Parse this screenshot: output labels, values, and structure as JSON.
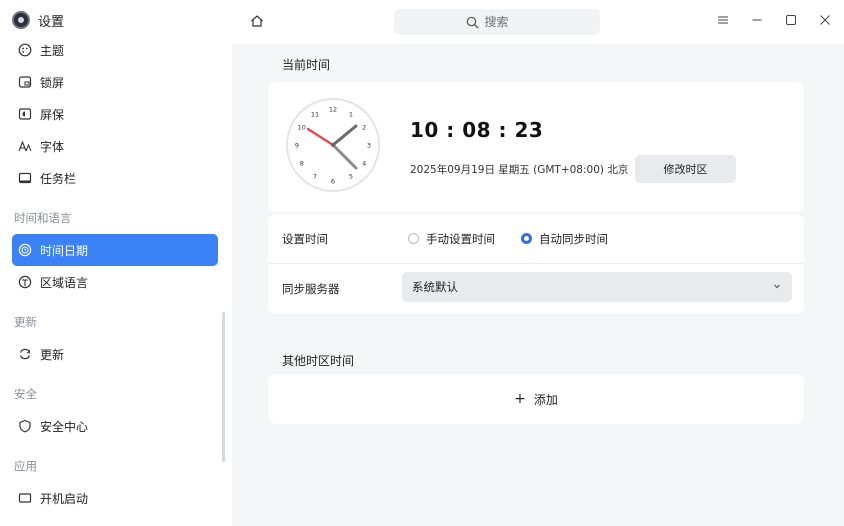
{
  "app": {
    "title": "设置",
    "logo_icon": "settings-app-icon"
  },
  "search": {
    "placeholder": "搜索",
    "icon": "search-icon"
  },
  "window_controls": {
    "menu": "menu-icon",
    "minimize": "minimize-icon",
    "maximize": "maximize-icon",
    "close": "close-icon"
  },
  "sidebar": {
    "items_top": [
      {
        "label": "主题",
        "icon": "theme-icon"
      },
      {
        "label": "锁屏",
        "icon": "lockscreen-icon"
      },
      {
        "label": "屏保",
        "icon": "screensaver-icon"
      },
      {
        "label": "字体",
        "icon": "font-icon"
      },
      {
        "label": "任务栏",
        "icon": "taskbar-icon"
      }
    ],
    "section_time": "时间和语言",
    "items_time": [
      {
        "label": "时间日期",
        "icon": "clock-icon",
        "active": true
      },
      {
        "label": "区域语言",
        "icon": "globe-icon"
      }
    ],
    "section_update": "更新",
    "items_update": [
      {
        "label": "更新",
        "icon": "refresh-icon"
      }
    ],
    "section_security": "安全",
    "items_security": [
      {
        "label": "安全中心",
        "icon": "shield-icon"
      }
    ],
    "section_apps": "应用",
    "items_apps": [
      {
        "label": "开机启动",
        "icon": "startup-icon"
      }
    ]
  },
  "main": {
    "current_time_title": "当前时间",
    "clock_numbers": [
      "12",
      "1",
      "2",
      "3",
      "4",
      "5",
      "6",
      "7",
      "8",
      "9",
      "10",
      "11"
    ],
    "time": "10 : 08 : 23",
    "date": "2025年09月19日 星期五 (GMT+08:00) 北京",
    "change_tz_label": "修改时区",
    "set_time_label": "设置时间",
    "manual_label": "手动设置时间",
    "auto_label": "自动同步时间",
    "selected_mode": "auto",
    "sync_server_label": "同步服务器",
    "sync_server_value": "系统默认",
    "other_tz_title": "其他时区时间",
    "add_label": "添加"
  },
  "colors": {
    "accent": "#3b82f6",
    "radio_accent": "#2f6fe4",
    "second_hand": "#e5484d",
    "content_bg": "#f5f6f8"
  }
}
